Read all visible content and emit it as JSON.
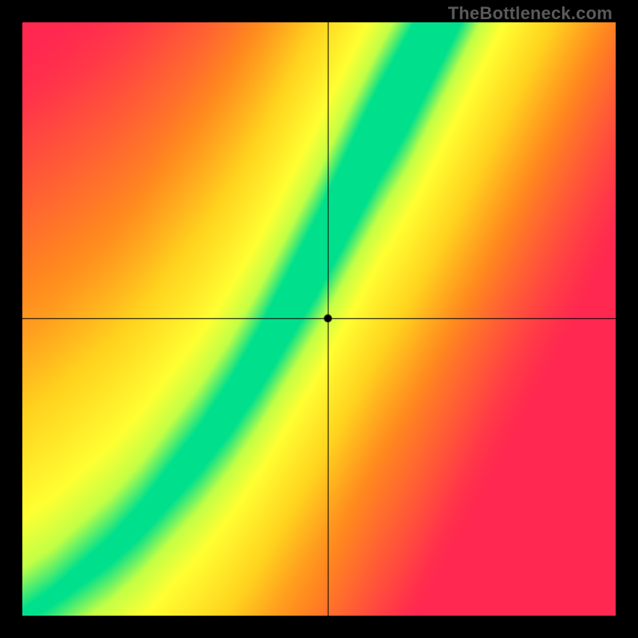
{
  "watermark": "TheBottleneck.com",
  "chart_data": {
    "type": "heatmap",
    "title": "",
    "xlabel": "",
    "ylabel": "",
    "xlim": [
      0,
      1
    ],
    "ylim": [
      0,
      1
    ],
    "grid": false,
    "legend": false,
    "crosshair": {
      "x": 0.515,
      "y": 0.501
    },
    "marker": {
      "x": 0.515,
      "y": 0.501,
      "radius_px": 5
    },
    "color_stops": [
      {
        "value": 0.0,
        "color": "#ff2850"
      },
      {
        "value": 0.33,
        "color": "#ff8a1e"
      },
      {
        "value": 0.55,
        "color": "#ffd21e"
      },
      {
        "value": 0.78,
        "color": "#ffff32"
      },
      {
        "value": 0.9,
        "color": "#c2ff46"
      },
      {
        "value": 1.0,
        "color": "#00e08c"
      }
    ],
    "optimal_curve_samples": [
      {
        "x": 0.0,
        "y": 0.0
      },
      {
        "x": 0.05,
        "y": 0.03
      },
      {
        "x": 0.1,
        "y": 0.07
      },
      {
        "x": 0.15,
        "y": 0.11
      },
      {
        "x": 0.2,
        "y": 0.16
      },
      {
        "x": 0.25,
        "y": 0.22
      },
      {
        "x": 0.3,
        "y": 0.28
      },
      {
        "x": 0.35,
        "y": 0.35
      },
      {
        "x": 0.4,
        "y": 0.43
      },
      {
        "x": 0.45,
        "y": 0.52
      },
      {
        "x": 0.5,
        "y": 0.61
      },
      {
        "x": 0.55,
        "y": 0.71
      },
      {
        "x": 0.6,
        "y": 0.81
      },
      {
        "x": 0.65,
        "y": 0.9
      },
      {
        "x": 0.7,
        "y": 1.0
      }
    ],
    "band_half_width_norm_start": 0.01,
    "band_half_width_norm_end": 0.08,
    "grid_resolution": 372
  }
}
